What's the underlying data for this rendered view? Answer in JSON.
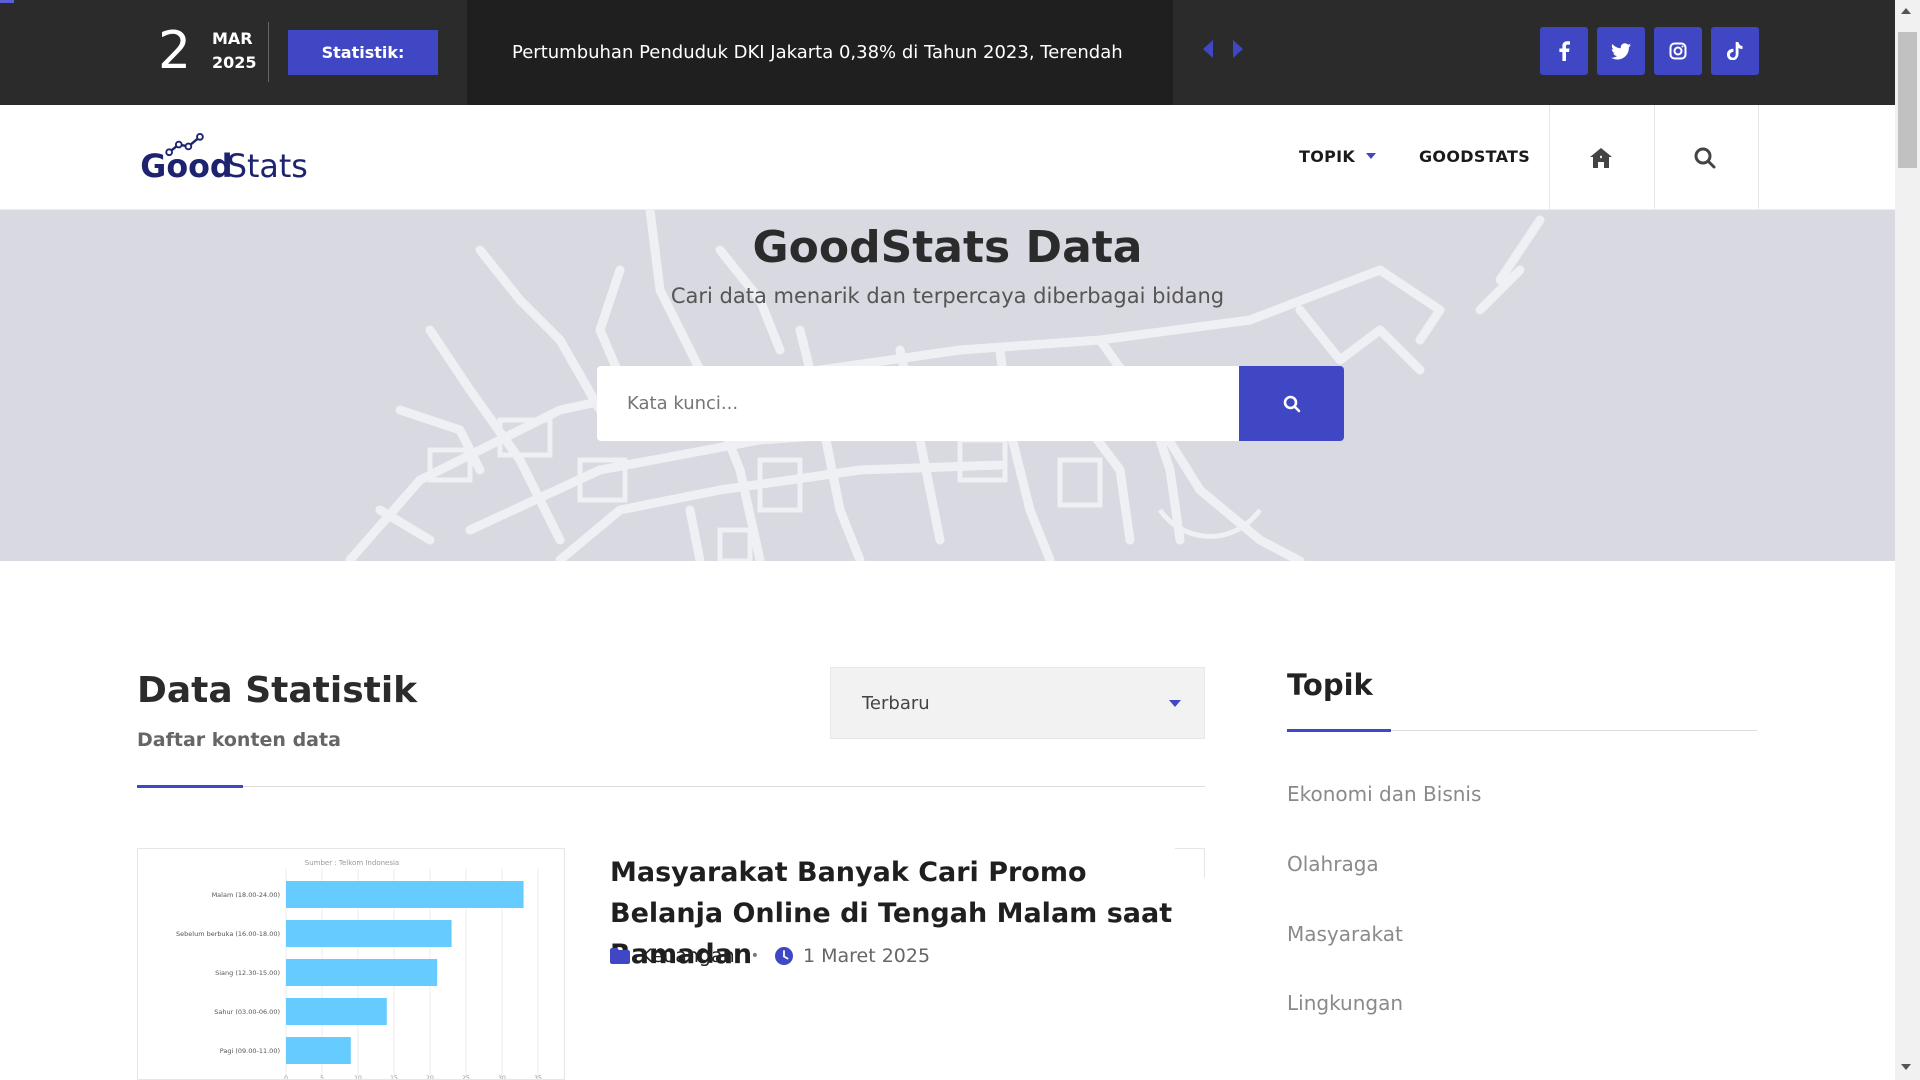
{
  "topbar": {
    "date_day": "2",
    "date_month": "MAR",
    "date_year": "2025",
    "stat_label": "Statistik:",
    "ticker_text": "Pertumbuhan Penduduk DKI Jakarta 0,38% di Tahun 2023, Terendah",
    "social": [
      {
        "icon": "facebook-icon",
        "glyph": "f"
      },
      {
        "icon": "twitter-icon",
        "glyph": "t"
      },
      {
        "icon": "instagram-icon",
        "glyph": "◎"
      },
      {
        "icon": "tiktok-icon",
        "glyph": "♪"
      }
    ]
  },
  "nav": {
    "logo_text_a": "Good",
    "logo_text_b": "Stats",
    "items": [
      "TOPIK",
      "GOODSTATS"
    ]
  },
  "hero": {
    "title": "GoodStats Data",
    "subtitle": "Cari data menarik dan terpercaya diberbagai bidang",
    "search_placeholder": "Kata kunci..."
  },
  "main": {
    "title": "Data Statistik",
    "subtitle": "Daftar konten data",
    "sort_value": "Terbaru",
    "card": {
      "title": "Masyarakat Banyak Cari Promo Belanja Online di Tengah Malam saat Ramadan",
      "category": "Keuangan",
      "date": "1 Maret 2025",
      "thumb_source": "Sumber : Telkom Indonesia",
      "thumb_bars": [
        {
          "label": "Malam (18.00-24.00)",
          "value": 33
        },
        {
          "label": "Sebelum berbuka (16.00-18.00)",
          "value": 23
        },
        {
          "label": "Siang (12.30-15.00)",
          "value": 21
        },
        {
          "label": "Sahur (03.00-06.00)",
          "value": 14
        },
        {
          "label": "Pagi (09.00-11.00)",
          "value": 9
        }
      ],
      "thumb_ticks": [
        "0",
        "5",
        "10",
        "15",
        "20",
        "25",
        "30",
        "35"
      ]
    }
  },
  "sidebar": {
    "title": "Topik",
    "topics": [
      "Ekonomi dan Bisnis",
      "Olahraga",
      "Masyarakat",
      "Lingkungan"
    ]
  },
  "colors": {
    "accent": "#3f47c4",
    "topbar": "#2b2b2b",
    "hero_bg": "#d8d9e1",
    "bar": "#66ccff"
  }
}
